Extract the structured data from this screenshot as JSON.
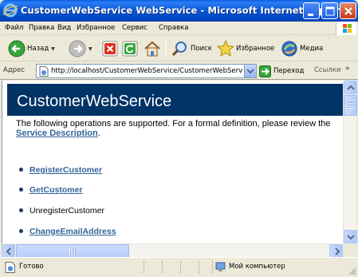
{
  "window": {
    "title": "CustomerWebService WebService - Microsoft Internet Explorer",
    "colors": {
      "titlebar": "#0b5bd8",
      "close": "#c5391a"
    }
  },
  "menubar": {
    "items": [
      "Файл",
      "Правка",
      "Вид",
      "Избранное",
      "Сервис",
      "Справка"
    ]
  },
  "toolbar": {
    "back_label": "Назад",
    "search_label": "Поиск",
    "favorites_label": "Избранное",
    "media_label": "Медиа",
    "icons": [
      "back-icon",
      "forward-icon",
      "stop-icon",
      "refresh-icon",
      "home-icon",
      "search-icon",
      "favorites-star-icon",
      "media-icon"
    ]
  },
  "addressbar": {
    "label": "Адрес",
    "url": "http://localhost/CustomerWebService/CustomerWebService",
    "go_label": "Переход",
    "links_label": "Ссылки"
  },
  "page": {
    "heading": "CustomerWebService",
    "heading_color": "#003366",
    "intro_text": "The following operations are supported. For a formal definition, please review the",
    "service_description_link": "Service Description",
    "period": ".",
    "link_color": "#336699",
    "operations": [
      {
        "label": "RegisterCustomer",
        "is_link": true
      },
      {
        "label": "GetCustomer",
        "is_link": true
      },
      {
        "label": "UnregisterCustomer",
        "is_link": false
      },
      {
        "label": "ChangeEmailAddress",
        "is_link": true
      }
    ]
  },
  "statusbar": {
    "status_text": "Готово",
    "zone_text": "Мой компьютер"
  }
}
